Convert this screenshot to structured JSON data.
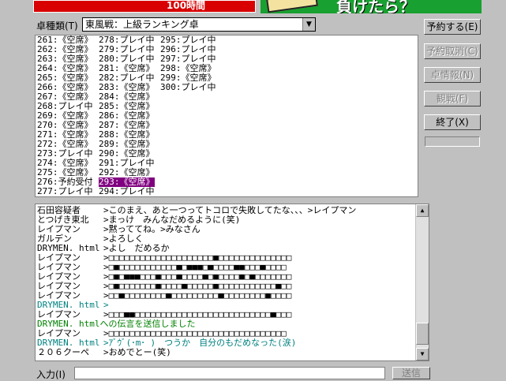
{
  "banner": {
    "left_text": "100時間",
    "right_text": "負けたら？"
  },
  "table_type": {
    "label": "卓種類(T)",
    "value": "東風戦：上級ランキング卓"
  },
  "tables": {
    "col1": [
      "261:《空席》",
      "262:《空席》",
      "263:《空席》",
      "264:《空席》",
      "265:《空席》",
      "266:《空席》",
      "267:《空席》",
      "268:プレイ中",
      "269:《空席》",
      "270:《空席》",
      "271:《空席》",
      "272:《空席》",
      "273:プレイ中",
      "274:《空席》",
      "275:《空席》",
      "276:予約受付",
      "277:プレイ中"
    ],
    "col2": [
      "278:プレイ中",
      "279:プレイ中",
      "280:プレイ中",
      "281:《空席》",
      "282:プレイ中",
      "283:《空席》",
      "284:《空席》",
      "285:《空席》",
      "286:《空席》",
      "287:《空席》",
      "288:《空席》",
      "289:《空席》",
      "290:《空席》",
      "291:プレイ中",
      "292:《空席》",
      "293:《空席》",
      "294:プレイ中"
    ],
    "col3": [
      "295:プレイ中",
      "296:プレイ中",
      "297:プレイ中",
      "298:《空席》",
      "299:《空席》",
      "300:プレイ中"
    ]
  },
  "chat": [
    {
      "name": "石田容疑者",
      "msg": ">このまえ、あと一つってトコロで失敗してたな、、、>レイプマン",
      "style": ""
    },
    {
      "name": "とつげき東北",
      "msg": ">まっけ　みんなだめるように(笑)",
      "style": ""
    },
    {
      "name": "レイプマン",
      "msg": ">黙っててね。>みなさん",
      "style": ""
    },
    {
      "name": "ガルデン",
      "msg": ">よろしく",
      "style": ""
    },
    {
      "name": "DRYMEN. html",
      "msg": ">よし　だめるか",
      "style": ""
    },
    {
      "name": "レイプマン",
      "msg": ">□□□□□□□□□□□□□□□□□□□□■□□□□□□□□□□□□□□",
      "style": ""
    },
    {
      "name": "レイプマン",
      "msg": ">□■□□□□□□□□□□□■□■■■□■□□□□■■□□□■□□□□",
      "style": ""
    },
    {
      "name": "レイプマン",
      "msg": ">□■□■■■□□□■□□□■□□□□■□■□□□□■□■□□□□□□□",
      "style": ""
    },
    {
      "name": "レイプマン",
      "msg": ">□■□□□□□□□■□□□□■□□□□□■□□□□□□□□□□□■□□",
      "style": ""
    },
    {
      "name": "レイプマン",
      "msg": ">□□■□□□□□□□□■□□□□□□□□□■□□□□□□□□■□□□□",
      "style": ""
    },
    {
      "name": "DRYMEN. html",
      "msg": ">",
      "style": "teal"
    },
    {
      "name": "レイプマン",
      "msg": ">□□□■■□□□□□□□□□□□□□□□□□□□□□□□□□□■□□□",
      "style": ""
    },
    {
      "name": "",
      "msg": "DRYMEN. htmlへの伝言を送信しました",
      "style": "green"
    },
    {
      "name": "レイプマン",
      "msg": ">□□□□□□□□□□□□□□□□□□□□□□□□□□□□□□□□□□",
      "style": ""
    },
    {
      "name": "DRYMEN. html",
      "msg": ">ｱﾞｳﾞ(･m･ )　つうか　自分のもだめなった(涙)",
      "style": "teal"
    },
    {
      "name": "２０６クーペ",
      "msg": ">おめでとー(笑)",
      "style": ""
    }
  ],
  "buttons": {
    "reserve": "予約する(E)",
    "cancel": "予約取消(C)",
    "table_info": "卓情報(N)",
    "watch": "観戦(F)",
    "exit": "終了(X)"
  },
  "input": {
    "label": "入力(I)",
    "send": "送信"
  }
}
